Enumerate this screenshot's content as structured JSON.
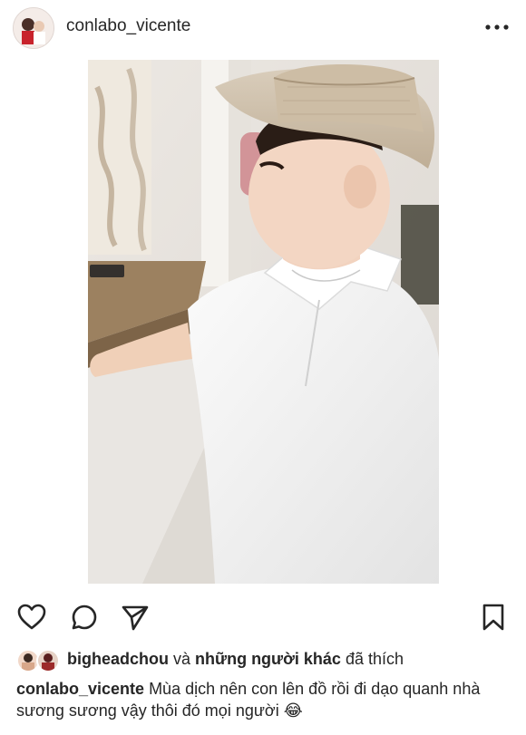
{
  "post": {
    "username": "conlabo_vicente",
    "more_icon": "more-horizontal-icon"
  },
  "actions": {
    "like_icon": "heart-icon",
    "comment_icon": "comment-icon",
    "share_icon": "paper-plane-icon",
    "save_icon": "bookmark-icon"
  },
  "likes": {
    "liker": "bigheadchou",
    "connector": "và",
    "others": "những người khác",
    "suffix": "đã thích"
  },
  "caption": {
    "username": "conlabo_vicente",
    "text": "Mùa dịch nên con lên đồ rồi đi dạo quanh nhà sương sương vậy thôi đó mọi người",
    "emoji": "😂"
  }
}
